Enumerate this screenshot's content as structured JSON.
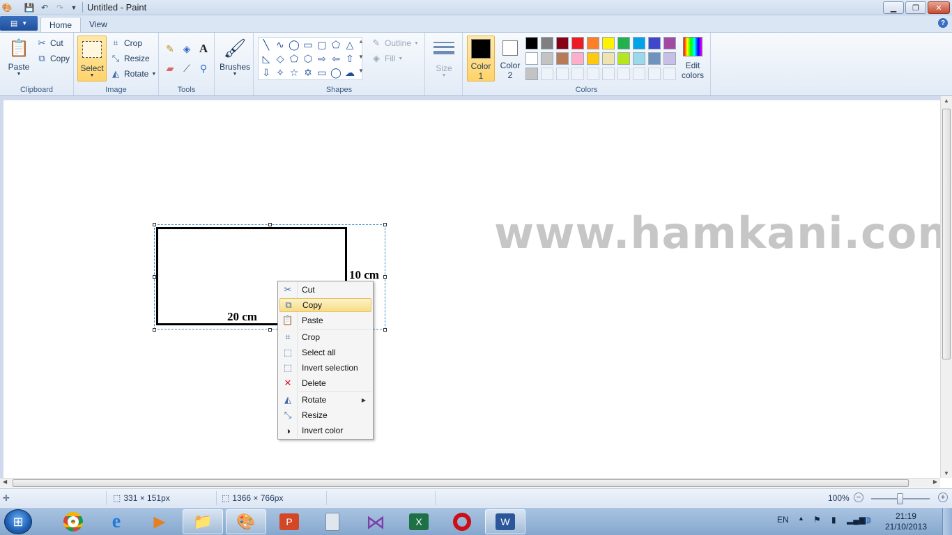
{
  "window": {
    "title": "Untitled - Paint"
  },
  "tabs": [
    {
      "label": "Home"
    },
    {
      "label": "View"
    }
  ],
  "ribbon": {
    "clipboard": {
      "group_label": "Clipboard",
      "paste": "Paste",
      "cut": "Cut",
      "copy": "Copy"
    },
    "image": {
      "group_label": "Image",
      "select": "Select",
      "crop": "Crop",
      "resize": "Resize",
      "rotate": "Rotate"
    },
    "tools": {
      "group_label": "Tools"
    },
    "brushes": {
      "label": "Brushes"
    },
    "shapes": {
      "group_label": "Shapes",
      "outline": "Outline",
      "fill": "Fill"
    },
    "size": {
      "label": "Size"
    },
    "colors": {
      "group_label": "Colors",
      "color1_line1": "Color",
      "color1_line2": "1",
      "color2_line1": "Color",
      "color2_line2": "2",
      "edit_line1": "Edit",
      "edit_line2": "colors",
      "color1_value": "#000000",
      "color2_value": "#ffffff",
      "palette_row1": [
        "#000000",
        "#7f7f7f",
        "#880015",
        "#ed1c24",
        "#ff7f27",
        "#fff200",
        "#22b14c",
        "#00a2e8",
        "#3f48cc",
        "#a349a4"
      ],
      "palette_row2": [
        "#ffffff",
        "#c3c3c3",
        "#b97a57",
        "#ffaec9",
        "#ffc90e",
        "#efe4b0",
        "#b5e61d",
        "#99d9ea",
        "#7092be",
        "#c8bfe7"
      ],
      "palette_row3_filled": [
        "#c3c3c3"
      ]
    }
  },
  "canvas": {
    "width_label": "20 cm",
    "height_label": "10 cm",
    "watermark": "www.hamkani.com"
  },
  "context_menu": {
    "items": [
      {
        "label": "Cut",
        "icon": "scissors-icon"
      },
      {
        "label": "Copy",
        "icon": "copy-icon"
      },
      {
        "label": "Paste",
        "icon": "paste-icon"
      },
      {
        "label": "Crop",
        "icon": "crop-icon"
      },
      {
        "label": "Select all",
        "icon": "select-all-icon"
      },
      {
        "label": "Invert selection",
        "icon": "invert-selection-icon"
      },
      {
        "label": "Delete",
        "icon": "delete-icon"
      },
      {
        "label": "Rotate",
        "icon": "rotate-icon"
      },
      {
        "label": "Resize",
        "icon": "resize-icon"
      },
      {
        "label": "Invert color",
        "icon": "invert-color-icon"
      }
    ],
    "highlighted": "Copy"
  },
  "statusbar": {
    "selection_size": "331 × 151px",
    "image_size": "1366 × 766px",
    "zoom": "100%"
  },
  "taskbar": {
    "language": "EN",
    "time": "21:19",
    "date": "21/10/2013"
  }
}
